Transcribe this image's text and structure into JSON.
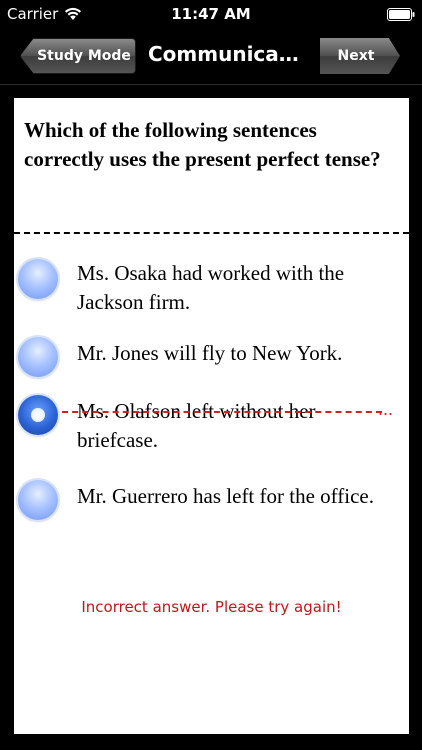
{
  "status_bar": {
    "carrier": "Carrier",
    "time": "11:47 AM"
  },
  "nav": {
    "back_label": "Study Mode",
    "title": "Communicati...",
    "next_label": "Next"
  },
  "question": {
    "text": "Which of the following sentences correctly uses the present perfect tense?"
  },
  "options": [
    {
      "text": "Ms. Osaka had worked with the Jackson firm.",
      "selected": false
    },
    {
      "text": "Mr. Jones will fly to New York.",
      "selected": false
    },
    {
      "text": "Ms. Olafson left without her briefcase.",
      "selected": true,
      "struck": true
    },
    {
      "text": "Mr. Guerrero has left for the office.",
      "selected": false
    }
  ],
  "feedback": {
    "text": "Incorrect answer. Please try again!",
    "color": "#c0171a"
  }
}
